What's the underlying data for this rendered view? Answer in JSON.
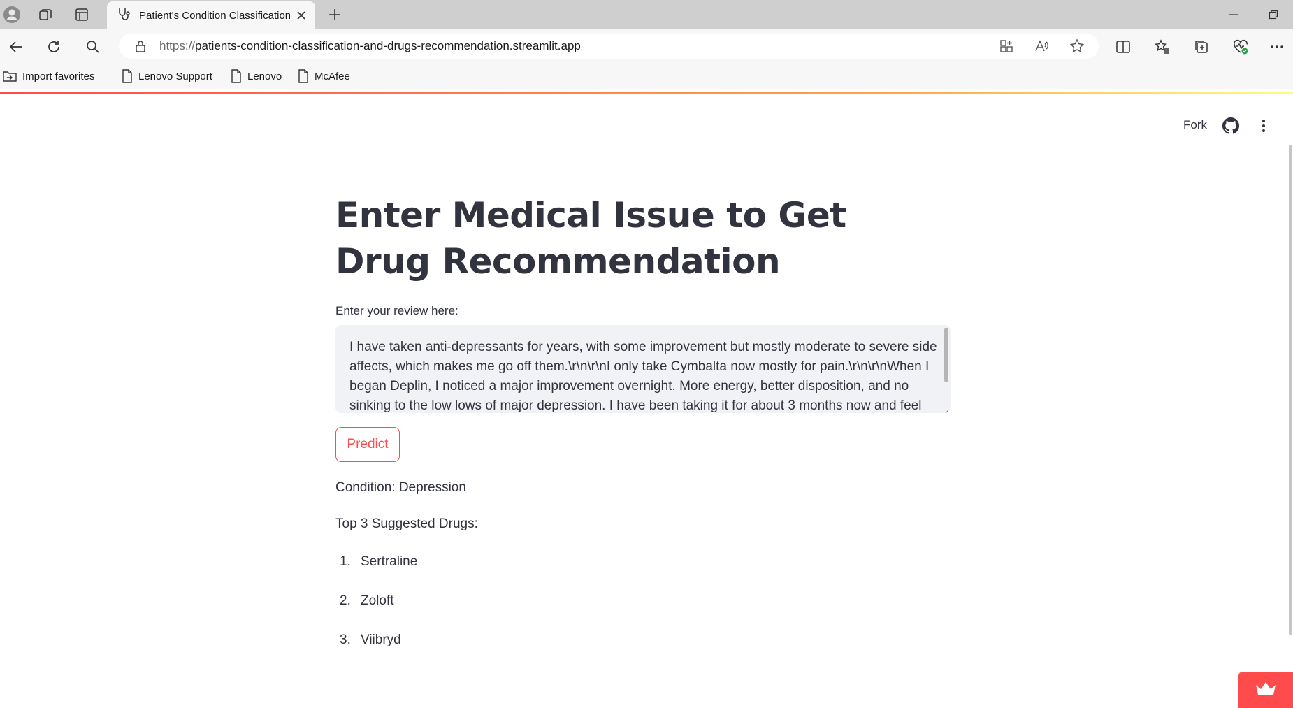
{
  "browser": {
    "tab_title": "Patient's Condition Classification and Drugs Recommendation",
    "url_protocol": "https://",
    "url_host": "patients-condition-classification-and-drugs-recommendation.streamlit.app",
    "bookmarks": [
      {
        "label": "Import favorites",
        "icon": "folder-import-icon"
      },
      {
        "label": "Lenovo Support",
        "icon": "page-icon"
      },
      {
        "label": "Lenovo",
        "icon": "page-icon"
      },
      {
        "label": "McAfee",
        "icon": "page-icon"
      }
    ]
  },
  "header": {
    "fork_label": "Fork"
  },
  "main": {
    "title": "Enter Medical Issue to Get Drug Recommendation",
    "review_label": "Enter your review here:",
    "review_text": "I have taken anti-depressants for years, with some improvement but mostly moderate to severe side affects, which makes me go off them.\\r\\n\\r\\nI only take Cymbalta now mostly for pain.\\r\\n\\r\\nWhen I began Deplin, I noticed a major improvement overnight. More energy, better disposition, and no sinking to the low lows of major depression. I have been taking it for about 3 months now and feel",
    "predict_label": "Predict",
    "condition_text": "Condition: Depression",
    "top_drugs_heading": "Top 3 Suggested Drugs:",
    "drugs": [
      {
        "num": "1.",
        "name": "Sertraline"
      },
      {
        "num": "2.",
        "name": "Zoloft"
      },
      {
        "num": "3.",
        "name": "Viibryd"
      }
    ]
  },
  "colors": {
    "accent": "#ff4b4b",
    "text": "#31333f",
    "input_bg": "#f0f2f6"
  }
}
